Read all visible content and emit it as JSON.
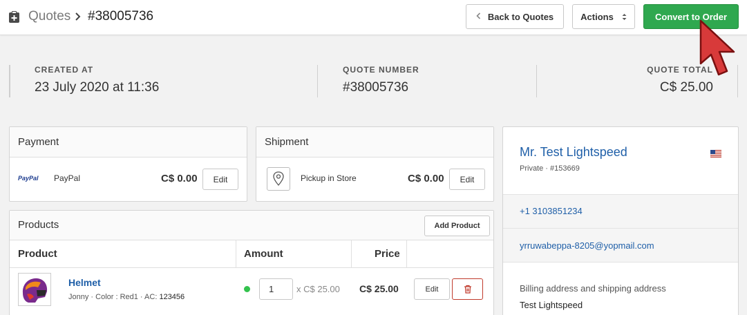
{
  "header": {
    "breadcrumb_section": "Quotes",
    "breadcrumb_separator": ">",
    "breadcrumb_current": "#38005736",
    "back_button": "Back to Quotes",
    "actions_button": "Actions",
    "convert_button": "Convert to Order",
    "icons": {
      "section": "quote-clipboard-icon",
      "back": "chevron-left-icon",
      "actions": "sort-updown-icon"
    }
  },
  "stats": {
    "created_label": "CREATED AT",
    "created_value": "23 July 2020 at 11:36",
    "number_label": "QUOTE NUMBER",
    "number_value": "#38005736",
    "total_label": "QUOTE TOTAL",
    "total_value": "C$ 25.00"
  },
  "payment": {
    "title": "Payment",
    "logo_text": "PayPal",
    "method": "PayPal",
    "amount": "C$ 0.00",
    "edit": "Edit"
  },
  "shipment": {
    "title": "Shipment",
    "icon": "map-pin-icon",
    "method": "Pickup in Store",
    "amount": "C$ 0.00",
    "edit": "Edit"
  },
  "products": {
    "title": "Products",
    "add_button": "Add Product",
    "columns": {
      "product": "Product",
      "amount": "Amount",
      "price": "Price"
    },
    "items": [
      {
        "name": "Helmet",
        "meta": "Jonny · Color : Red1 · AC:",
        "meta_code": "123456",
        "quantity": "1",
        "unit_price": "x C$ 25.00",
        "price": "C$ 25.00",
        "edit": "Edit",
        "delete_icon": "trash-icon",
        "status_color": "#33c24d"
      }
    ]
  },
  "customer": {
    "name": "Mr. Test Lightspeed",
    "subtitle": "Private · #153669",
    "flag_icon": "us-flag-icon",
    "phone": "+1 3103851234",
    "email": "yrruwabeppa-8205@yopmail.com",
    "address_label": "Billing address and shipping address",
    "address_name": "Test Lightspeed"
  },
  "colors": {
    "primary": "#2fa84f",
    "link": "#1f5fa8",
    "danger": "#c0392b"
  }
}
